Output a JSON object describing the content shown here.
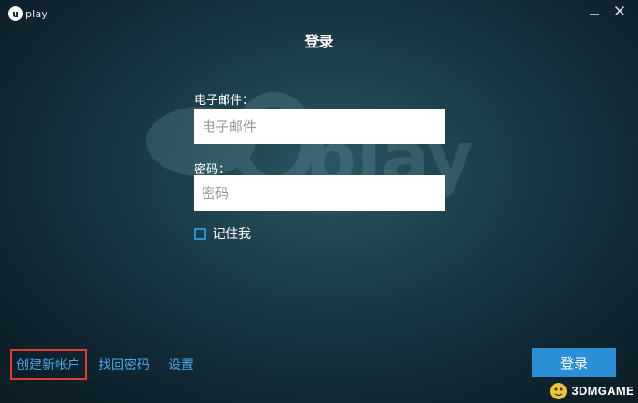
{
  "window": {
    "logo_text": "play",
    "title": "登录"
  },
  "form": {
    "email_label": "电子邮件：",
    "email_placeholder": "电子邮件",
    "password_label": "密码：",
    "password_placeholder": "密码",
    "remember_label": "记住我",
    "remember_checked": false
  },
  "links": {
    "create_account": "创建新帐户",
    "recover_password": "找回密码",
    "settings": "设置"
  },
  "login_button": "登录",
  "watermark": "3DMGAME",
  "colors": {
    "accent": "#2a8fd4",
    "link": "#4aa8e8",
    "highlight": "#e53935",
    "background": "#1a3a47"
  }
}
